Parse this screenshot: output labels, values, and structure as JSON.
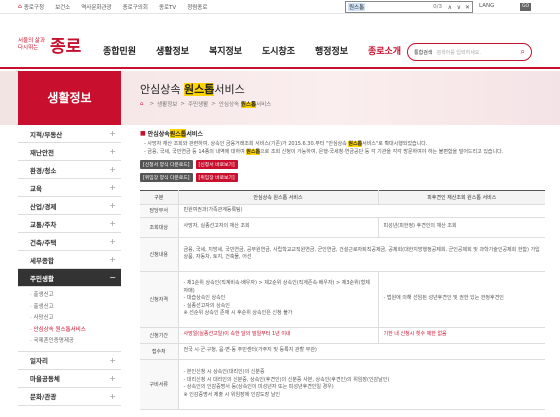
{
  "topbar": {
    "links": [
      "종로구청",
      "보건소",
      "역사문화관광",
      "종로구의회",
      "종로TV",
      "청렴종로"
    ],
    "find_query": "원스톱",
    "find_count": "0/3",
    "lang": "LANG",
    "go": "GO"
  },
  "header": {
    "logo_small": "서울의 삶과 다시뛰는",
    "logo_big": "종로",
    "gnb": [
      "종합민원",
      "생활정보",
      "복지정보",
      "도시창조",
      "행정정보",
      "종로소개"
    ],
    "search_select": "통합검색",
    "search_placeholder": "검색어를 입력하세요."
  },
  "sidebar": {
    "title": "생활정보",
    "items": [
      "지적/부동산",
      "재난안전",
      "환경/청소",
      "교육",
      "산업/경제",
      "교통/주차",
      "건축/주택",
      "세무종합",
      "주민생활"
    ],
    "sub": [
      "출생신고",
      "출생신고",
      "사망신고",
      "안심상속 원스톱서비스",
      "국제혼인증명제공"
    ],
    "after": [
      "일자리",
      "마을공동체",
      "문화/관광"
    ]
  },
  "page": {
    "title_pre": "안심상속 ",
    "title_hl": "원스톱",
    "title_post": "서비스",
    "crumbs": [
      "생활정보",
      "주민생활"
    ],
    "crumb_last_pre": "안심상속 ",
    "crumb_last_hl": "원스톱",
    "crumb_last_post": "서비스"
  },
  "section": {
    "title_pre": "안심상속 ",
    "title_hl": "원스톱",
    "title_post": "서비스",
    "p1_pre": "- 사망자 재산 조회와 관련하여, 상속인 금융거래조회 서비스(기존)가 2015.6.30.부터 \"안심상속 ",
    "p1_hl": "원스톱",
    "p1_post": "서비스\"로 확대시행되었습니다.",
    "p2_pre": "- 금융, 국세, 국민연금 등 14종의 내역에 대하여 ",
    "p2_hl": "원스톱",
    "p2_post": "으로 조회 신청이 가능하여, 은행·국세청·연금공단 등 각 기관을 각각 방문하여야 하는 불편함을 덜어드리고 있습니다.",
    "buttons": [
      "[신청서 양식 다운로드]",
      "[신청서 바로보기]",
      "[위임장 양식 다운로드]",
      "[위임장 바로보기]"
    ]
  },
  "table": {
    "headers": [
      "구분",
      "안심상속 원스톱 서비스",
      "피후견인 재산조회 원스톱 서비스"
    ],
    "rows": [
      {
        "label": "담당부서",
        "a": "민원여권과(가족관계등록팀)",
        "b": ""
      },
      {
        "label": "조회대상",
        "a": "사망자, 실종선고자의 재산 조회",
        "b": "피성년(피한정) 후견인의 재산 조회"
      },
      {
        "label": "신청내용",
        "a": "금융, 국세, 지방세, 국민연금, 공무원연금, 사립학교교직원연금, 군인연금, 건설근로자퇴직공제금, 공제회(대한지방행정공제회, 군인공제회 및 과학기술인공제회 한함) 가입상품, 자동차, 토지, 건축물, 어선",
        "b": ""
      },
      {
        "label": "신청자격",
        "a": "- 제1순위 상속인(직계비속·배우자) > 제2순위 상속인(직계존속·배우자) > 제3순위(형제자매)\n- 대습상속인 상속인\n- 실종선고자의 상속인\n※ 선순위 상속인 존재 시 후순위 상속인은 신청 불가",
        "b": "- 법원에 의해 선임된 성년후견인 및 권한 있는 한정후견인"
      },
      {
        "label": "신청기간",
        "a": "사망일(실종선고일)이 속한 달의 말일부터 1년 이내",
        "b": "기한 내 신청시 횟수 제한 없음"
      },
      {
        "label": "접수처",
        "a": "전국 시·군·구청, 읍·면·동 주민센터(가주지 및 등록지 관할 무관)",
        "b": ""
      },
      {
        "label": "구비서류",
        "a": "- 본인신청 시 상속인(대리인)의 신분증\n- 대리신청 시 대리인의 신분증, 상속인(후견인)의 신분증 사본, 상속인(후견인)의 위임장(인감날인)\n- 상속인의 인감증명서 등(상속인이 미성년자 또는 피성년후견인일 경우)\n※ 인감증명서 제출 시 위임장에 인감도장 날인",
        "b": ""
      }
    ]
  }
}
